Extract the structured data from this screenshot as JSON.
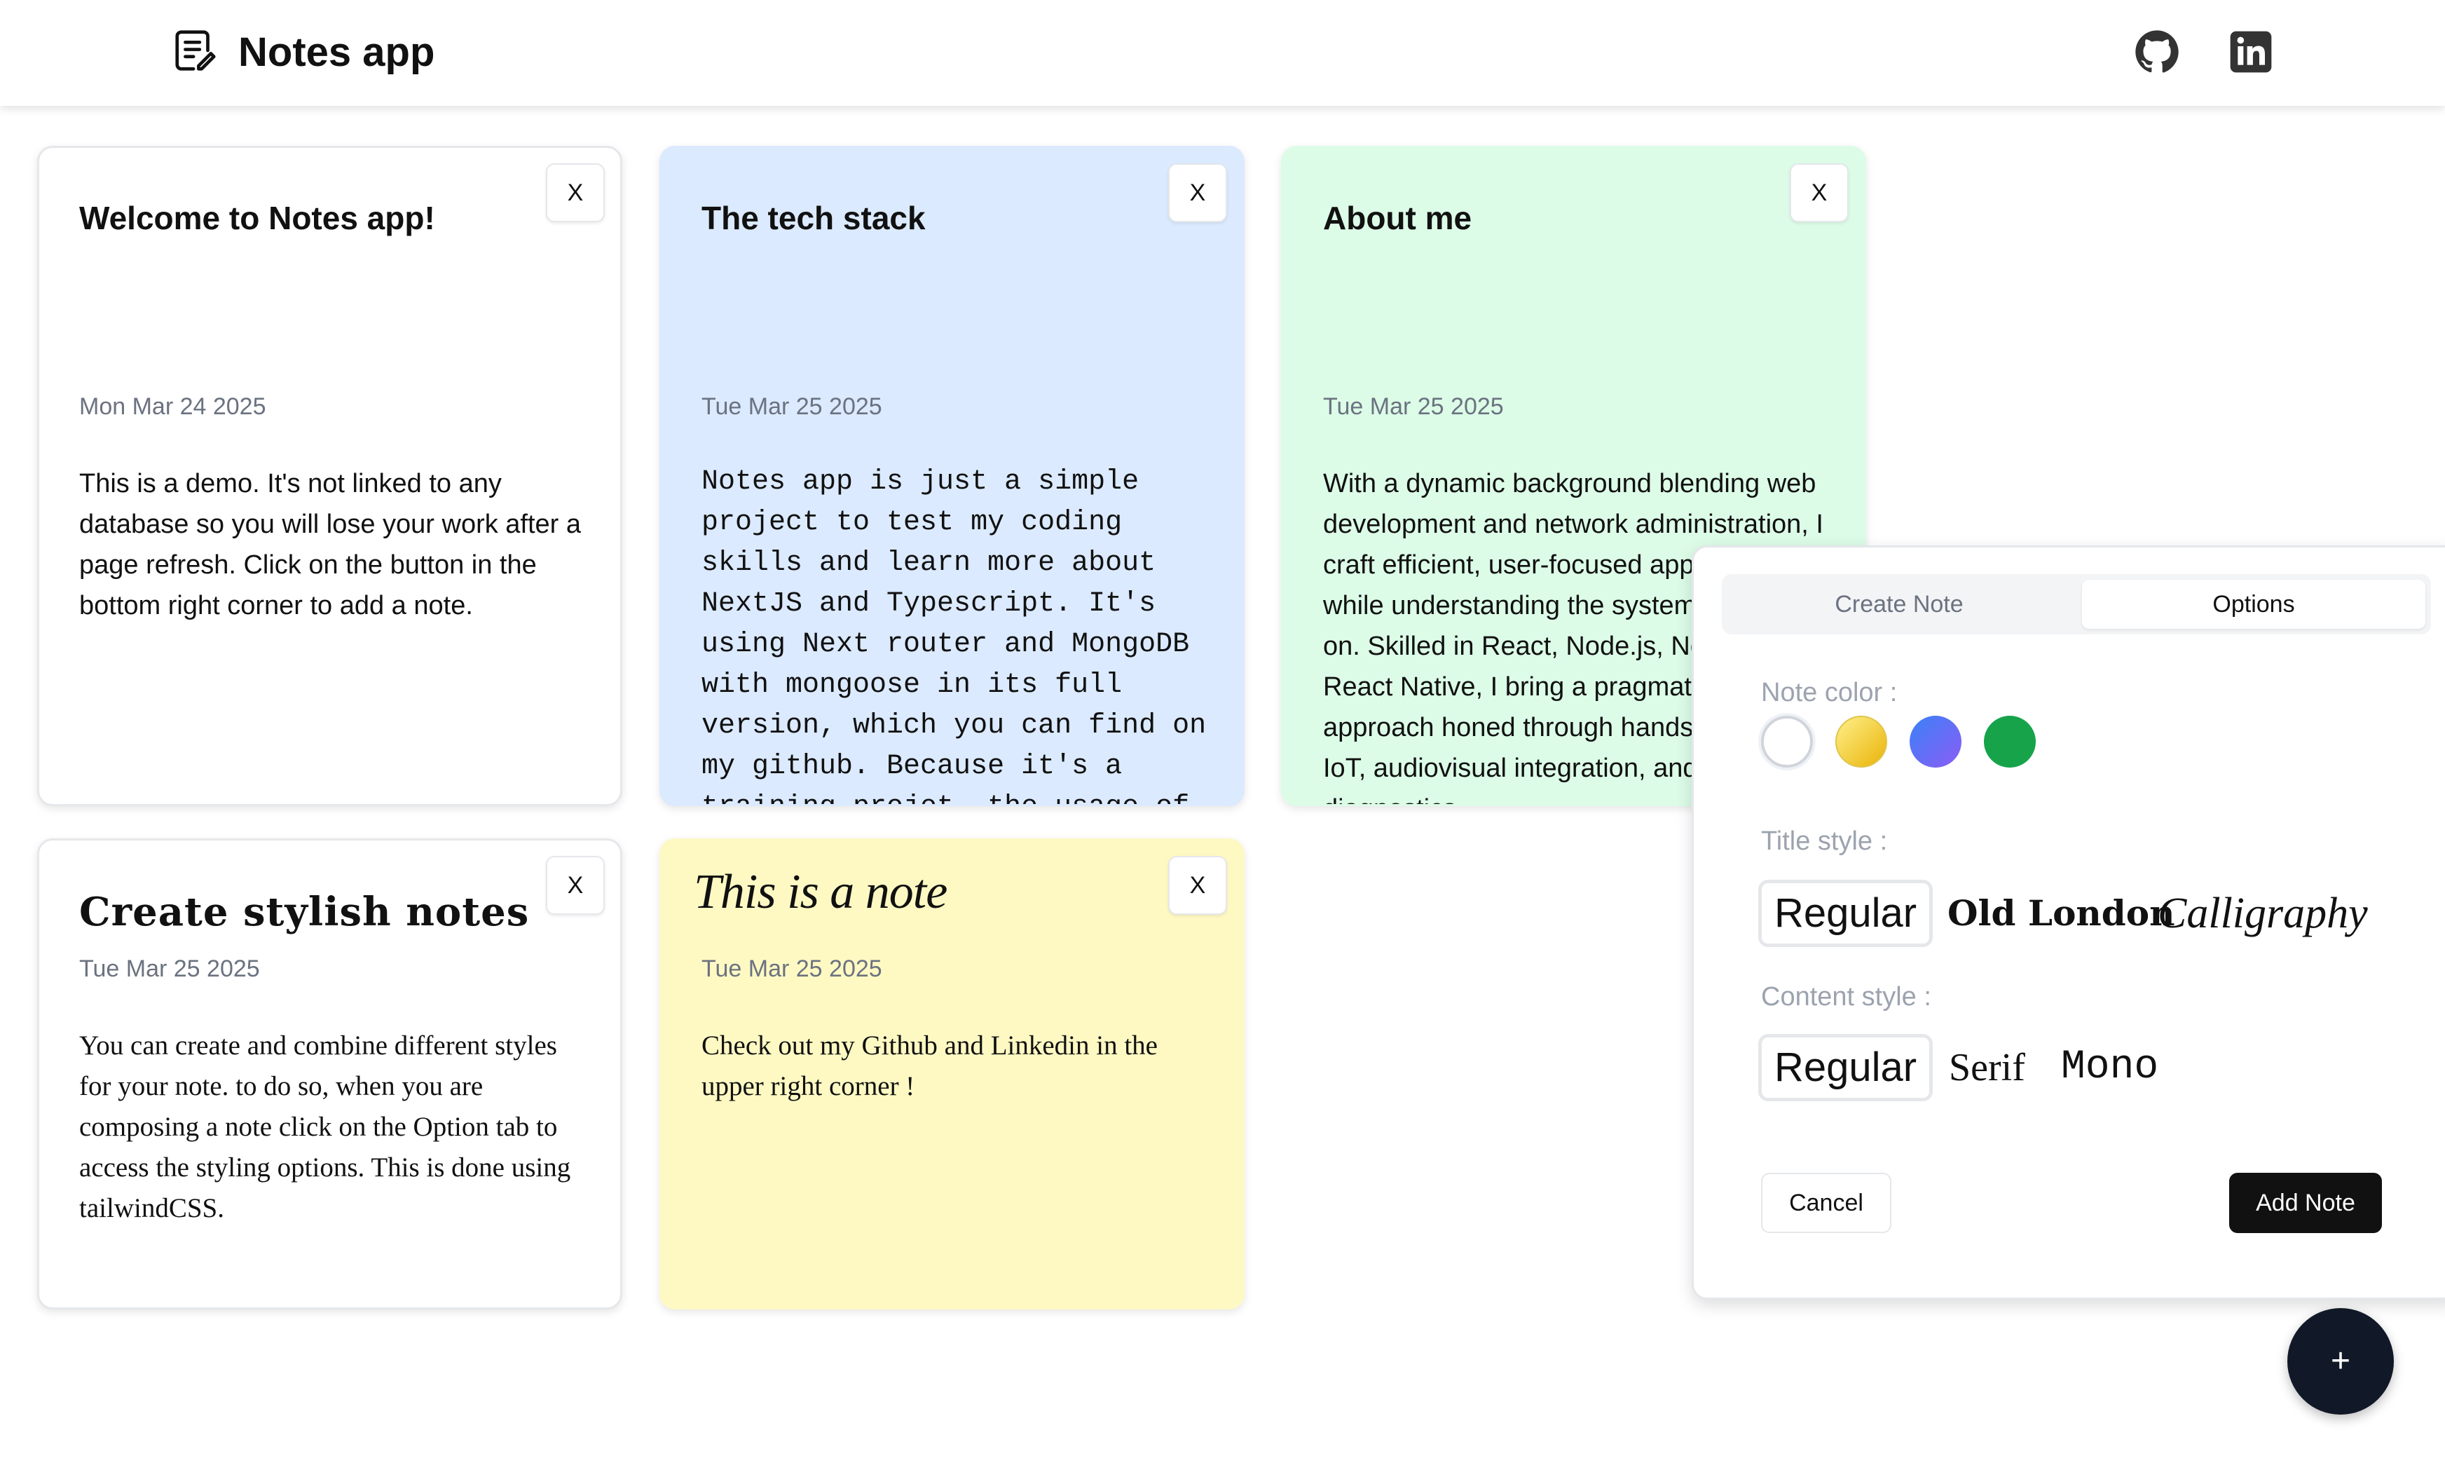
{
  "header": {
    "title": "Notes app",
    "logo_icon": "notepad-icon",
    "social": [
      {
        "name": "github-icon"
      },
      {
        "name": "linkedin-icon"
      }
    ]
  },
  "notes": [
    {
      "title": "Welcome to Notes app!",
      "date": "Mon Mar 24 2025",
      "content": "This is a demo. It's not linked to any database so you will lose your work after a page refresh. Click on the button in the bottom right corner to add a note.",
      "color": "#ffffff",
      "title_style": "Regular",
      "content_style": "Regular",
      "close_label": "X"
    },
    {
      "title": "The tech stack",
      "date": "Tue Mar 25 2025",
      "content": "Notes app is just a simple project to test my coding skills and learn more about NextJS and Typescript. It's using Next router and MongoDB with mongoose in its full version, which you can find on my github. Because it's a training projet, the usage of AI has been minimal if any.",
      "color": "#dbeafe",
      "title_style": "Regular",
      "content_style": "Mono",
      "close_label": "X"
    },
    {
      "title": "About me",
      "date": "Tue Mar 25 2025",
      "content": "With a dynamic background blending web development and network administration, I craft efficient, user-focused applications while understanding the systems they run on. Skilled in React, Node.js, Next.js, and React Native, I bring a pragmatic approach honed through hands-on work in IoT, audiovisual integration, and network diagnostics.",
      "color": "#dcfce7",
      "title_style": "Regular",
      "content_style": "Regular",
      "close_label": "X"
    },
    {
      "title": "Create stylish notes",
      "date": "Tue Mar 25 2025",
      "content": "You can create and combine different styles for your note. to do so, when you are composing a note click on the Option tab to access the styling options. This is done using tailwindCSS.",
      "color": "#ffffff",
      "title_style": "Old London",
      "content_style": "Serif",
      "close_label": "X"
    },
    {
      "title": "This is a note",
      "date": "Tue Mar 25 2025",
      "content": "Check out my Github and Linkedin in the upper right corner !",
      "color": "#fef9c3",
      "title_style": "Calligraphy",
      "content_style": "Serif",
      "close_label": "X"
    }
  ],
  "composer": {
    "tabs": [
      "Create Note",
      "Options"
    ],
    "active_tab": "Options",
    "note_color_label": "Note color :",
    "colors": [
      {
        "name": "white",
        "hex": "#ffffff",
        "selected": true
      },
      {
        "name": "yellow",
        "hex": "#facc15",
        "selected": false
      },
      {
        "name": "purple",
        "hex": "#6366f1",
        "selected": false
      },
      {
        "name": "green",
        "hex": "#16a34a",
        "selected": false
      }
    ],
    "title_style_label": "Title style :",
    "title_styles": [
      "Regular",
      "Old London",
      "Calligraphy"
    ],
    "title_style_selected": "Regular",
    "content_style_label": "Content style :",
    "content_styles": [
      "Regular",
      "Serif",
      "Mono"
    ],
    "content_style_selected": "Regular",
    "cancel_label": "Cancel",
    "add_label": "Add Note"
  },
  "fab": {
    "label": "+"
  }
}
